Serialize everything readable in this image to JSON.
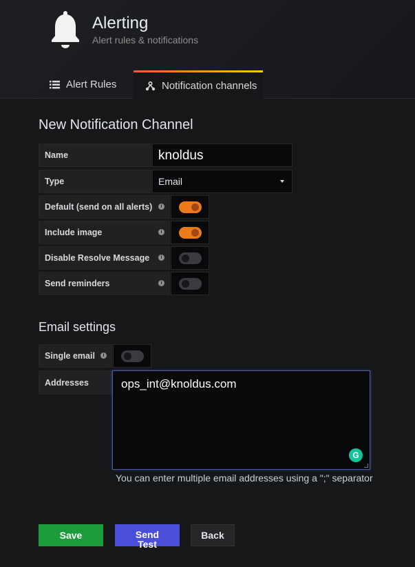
{
  "header": {
    "title": "Alerting",
    "subtitle": "Alert rules & notifications",
    "icon": "bell-icon"
  },
  "tabs": [
    {
      "label": "Alert Rules",
      "icon": "list-icon",
      "active": false
    },
    {
      "label": "Notification channels",
      "icon": "webhook-icon",
      "active": true
    }
  ],
  "form": {
    "title": "New Notification Channel",
    "name_label": "Name",
    "name_value": "knoldus",
    "type_label": "Type",
    "type_value": "Email",
    "toggles": [
      {
        "label": "Default (send on all alerts)",
        "on": true
      },
      {
        "label": "Include image",
        "on": true
      },
      {
        "label": "Disable Resolve Message",
        "on": false
      },
      {
        "label": "Send reminders",
        "on": false
      }
    ]
  },
  "email": {
    "title": "Email settings",
    "single_label": "Single email",
    "single_on": false,
    "addresses_label": "Addresses",
    "addresses_value": "ops_int@knoldus.com",
    "help": "You can enter multiple email addresses using a \";\" separator"
  },
  "buttons": {
    "save": "Save",
    "test_line1": "Send",
    "test_line2": "Test",
    "back": "Back"
  },
  "colors": {
    "accent_orange": "#eb7b18",
    "save_green": "#1c9b3a",
    "test_blue": "#4a4fd9"
  }
}
